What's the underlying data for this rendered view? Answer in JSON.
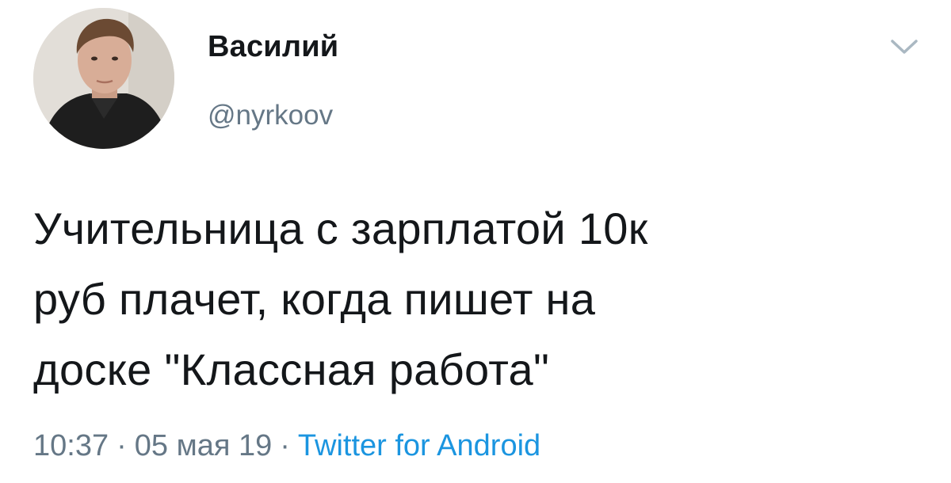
{
  "author": {
    "display_name": "Василий",
    "handle": "@nyrkoov"
  },
  "tweet": {
    "text": "Учительница с зарплатой 10к\nруб плачет, когда пишет на\nдоске \"Классная работа\"",
    "time": "10:37",
    "date": "05 мая 19",
    "separator": "·",
    "source": "Twitter for Android"
  },
  "icons": {
    "avatar": "user-avatar",
    "menu": "chevron-down-icon"
  },
  "colors": {
    "text_primary": "#14171a",
    "text_secondary": "#657786",
    "link": "#1b95e0"
  }
}
